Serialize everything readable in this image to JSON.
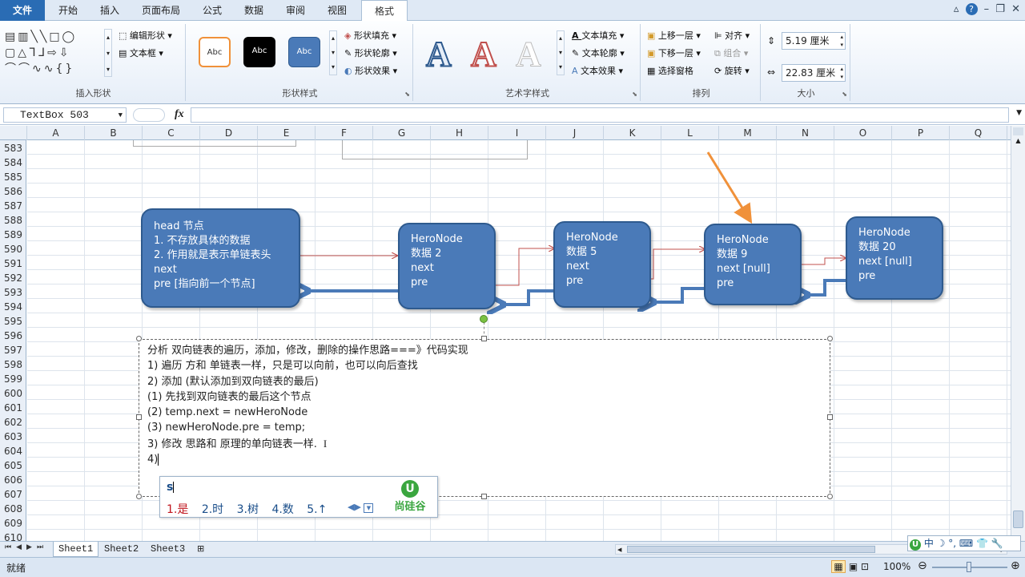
{
  "tabs": [
    "文件",
    "开始",
    "插入",
    "页面布局",
    "公式",
    "数据",
    "审阅",
    "视图",
    "格式"
  ],
  "ribbon": {
    "insert_shapes": {
      "edit_shape": "编辑形状",
      "textbox": "文本框",
      "label": "插入形状"
    },
    "shape_styles": {
      "sample": "Abc",
      "fill": "形状填充",
      "outline": "形状轮廓",
      "effects": "形状效果",
      "label": "形状样式"
    },
    "wordart": {
      "glyph": "A",
      "text_fill": "文本填充",
      "text_outline": "文本轮廓",
      "text_effects": "文本效果",
      "label": "艺术字样式"
    },
    "arrange": {
      "bring_forward": "上移一层",
      "send_backward": "下移一层",
      "selection_pane": "选择窗格",
      "align": "对齐",
      "group": "组合",
      "rotate": "旋转",
      "label": "排列"
    },
    "size": {
      "height": "5.19 厘米",
      "width": "22.83 厘米",
      "label": "大小"
    }
  },
  "formula_bar": {
    "name_box": "TextBox 503",
    "fx": "fx",
    "value": ""
  },
  "columns": [
    "A",
    "B",
    "C",
    "D",
    "E",
    "F",
    "G",
    "H",
    "I",
    "J",
    "K",
    "L",
    "M",
    "N",
    "O",
    "P",
    "Q"
  ],
  "rows": [
    "583",
    "584",
    "585",
    "586",
    "587",
    "588",
    "589",
    "590",
    "591",
    "592",
    "593",
    "594",
    "595",
    "596",
    "597",
    "598",
    "599",
    "600",
    "601",
    "602",
    "603",
    "604",
    "605",
    "606",
    "607",
    "608",
    "609",
    "610"
  ],
  "nodes": [
    {
      "lines": [
        "head 节点",
        "1. 不存放具体的数据",
        "2. 作用就是表示单链表头",
        "next",
        "pre  [指向前一个节点]"
      ]
    },
    {
      "lines": [
        "HeroNode",
        "数据 2",
        "next",
        "pre"
      ]
    },
    {
      "lines": [
        "HeroNode",
        "数据 5",
        "next",
        "pre"
      ]
    },
    {
      "lines": [
        "HeroNode",
        "数据 9",
        "next [null]",
        "pre"
      ]
    },
    {
      "lines": [
        "HeroNode",
        "数据 20",
        "next [null]",
        "pre"
      ]
    }
  ],
  "textbox": {
    "lines": [
      "分析 双向链表的遍历，添加，修改，删除的操作思路===》代码实现",
      "1) 遍历 方和 单链表一样，只是可以向前，也可以向后查找",
      "2) 添加 (默认添加到双向链表的最后)",
      "(1) 先找到双向链表的最后这个节点",
      "(2) temp.next = newHeroNode",
      "(3) newHeroNode.pre = temp;",
      "3) 修改 思路和 原理的单向链表一样.",
      "4)"
    ]
  },
  "ime": {
    "input": "s",
    "candidates": [
      "1.是",
      "2.时",
      "3.树",
      "4.数",
      "5.↑"
    ],
    "brand": "尚硅谷"
  },
  "sheets": [
    "Sheet1",
    "Sheet2",
    "Sheet3"
  ],
  "status": {
    "ready": "就绪",
    "zoom": "100%"
  },
  "ime_tray": [
    "中",
    "☽",
    "°,",
    "⌨",
    "👕",
    "🔧"
  ],
  "colors": {
    "accent": "#2a6cb4",
    "node_fill": "#4a7ab8",
    "node_border": "#2e5a8e",
    "arrow_orange": "#f0913a",
    "link_red": "#c0504d"
  }
}
